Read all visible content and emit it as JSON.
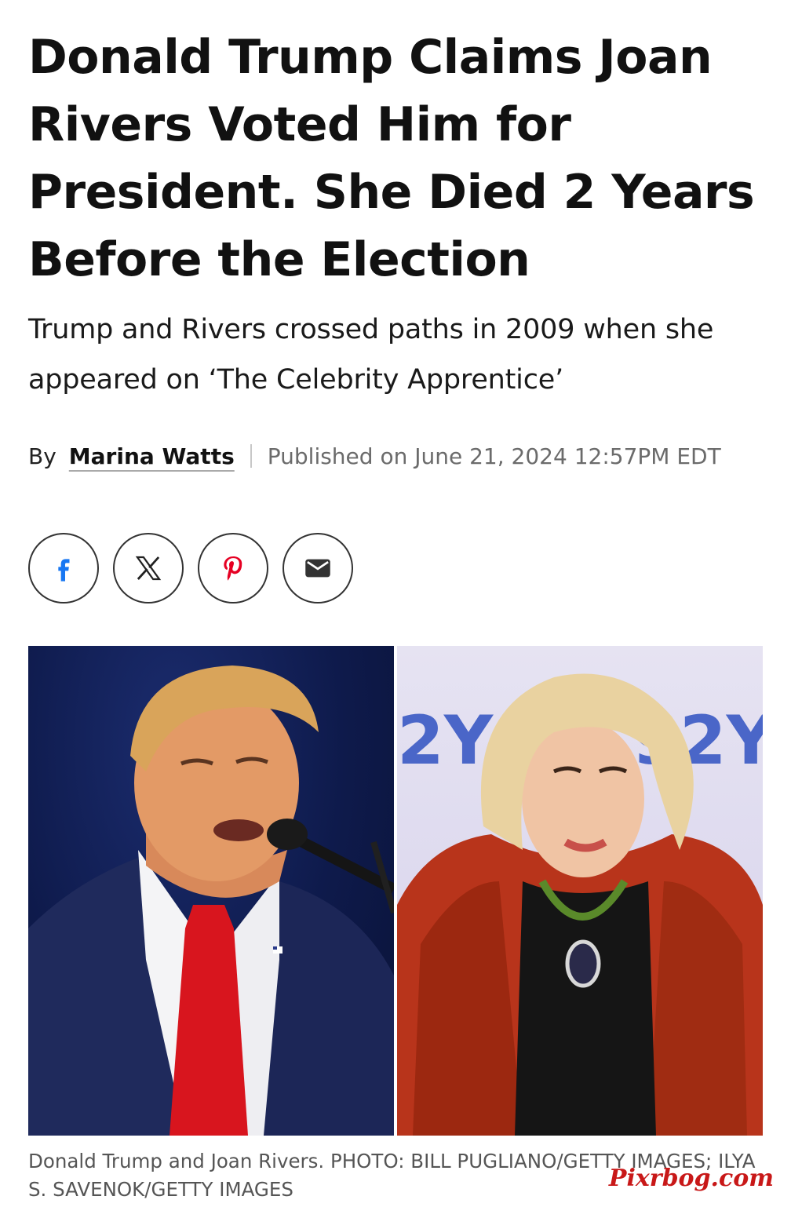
{
  "article": {
    "headline": "Donald Trump Claims Joan Rivers Voted Him for President. She Died 2 Years Before the Election",
    "subheadline": "Trump and Rivers crossed paths in 2009 when she appeared on ‘The Celebrity Apprentice’",
    "byline": {
      "by_label": "By",
      "author": "Marina Watts",
      "published": "Published on June 21, 2024 12:57PM EDT"
    },
    "share": [
      {
        "icon": "facebook-icon",
        "label": "Facebook"
      },
      {
        "icon": "x-icon",
        "label": "X"
      },
      {
        "icon": "pinterest-icon",
        "label": "Pinterest"
      },
      {
        "icon": "email-icon",
        "label": "Email"
      }
    ],
    "photo": {
      "left_backdrop_text": "",
      "right_backdrop_text": "2Y  92Y",
      "caption": "Donald Trump and Joan Rivers. PHOTO: BILL PUGLIANO/GETTY IMAGES; ILYA S. SAVENOK/GETTY IMAGES"
    }
  },
  "watermark": "Pixrbog.com",
  "colors": {
    "facebook": "#1877f2",
    "pinterest": "#e60023",
    "icon_dark": "#333333",
    "watermark": "#c81818"
  }
}
